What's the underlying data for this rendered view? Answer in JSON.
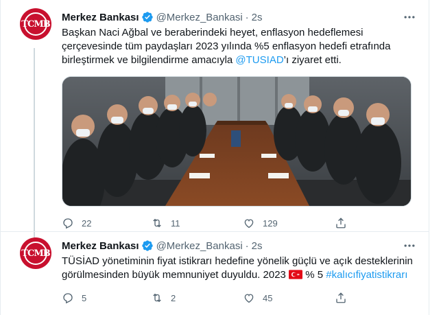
{
  "tweets": [
    {
      "author_name": "Merkez Bankası",
      "handle": "@Merkez_Bankasi",
      "separator": "·",
      "time": "2s",
      "avatar_text": "TCMB",
      "text_parts": [
        "Başkan Naci Ağbal ve beraberindeki heyet, enflasyon hedeflemesi çerçevesinde tüm paydaşları 2023 yılında %5 enflasyon hedefi etrafında birleştirmek ve bilgilendirme amacıyla ",
        "@TUSIAD",
        "’ı ziyaret etti."
      ],
      "reply_count": "22",
      "retweet_count": "11",
      "like_count": "129"
    },
    {
      "author_name": "Merkez Bankası",
      "handle": "@Merkez_Bankasi",
      "separator": "·",
      "time": "2s",
      "avatar_text": "TCMB",
      "text_parts": [
        "TÜSİAD yönetiminin fiyat istikrarı hedefine yönelik güçlü ve açık desteklerinin görülmesinden büyük memnuniyet duyuldu. 2023 ",
        " % 5 ",
        "#kalıcıfiyatistikrarı"
      ],
      "reply_count": "5",
      "retweet_count": "2",
      "like_count": "45"
    }
  ],
  "colors": {
    "brand_red": "#c8102e",
    "link_blue": "#1d9bf0",
    "secondary_text": "#536471",
    "divider": "#e6ecf0"
  },
  "icons": [
    "verified-badge-icon",
    "more-icon",
    "reply-icon",
    "retweet-icon",
    "like-icon",
    "share-icon",
    "turkey-flag-icon"
  ]
}
